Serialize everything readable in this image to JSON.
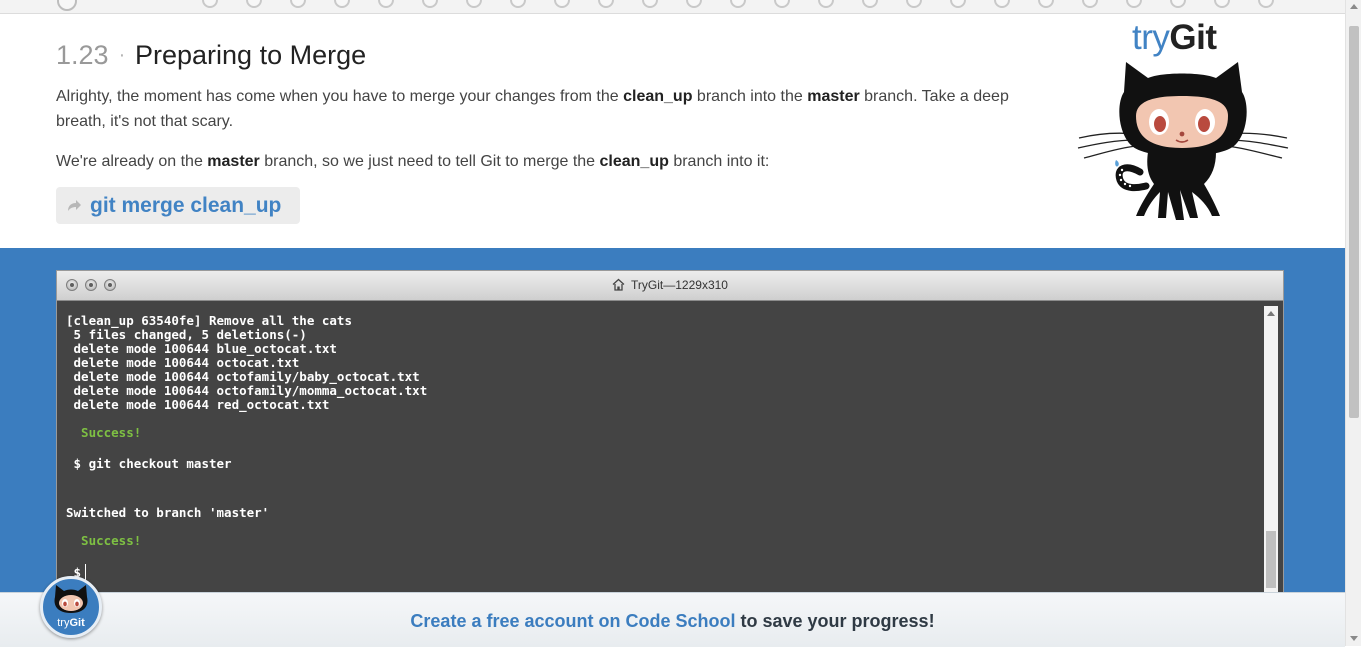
{
  "lesson": {
    "number": "1.23",
    "separator": "·",
    "title": "Preparing to Merge",
    "p1": [
      {
        "text": "Alrighty, the moment has come when you have to merge your changes from the ",
        "bold": false
      },
      {
        "text": "clean_up",
        "bold": true
      },
      {
        "text": " branch into the ",
        "bold": false
      },
      {
        "text": "master",
        "bold": true
      },
      {
        "text": " branch. Take a deep breath, it's not that scary.",
        "bold": false
      }
    ],
    "p2": [
      {
        "text": "We're already on the ",
        "bold": false
      },
      {
        "text": "master",
        "bold": true
      },
      {
        "text": " branch, so we just need to tell Git to merge the ",
        "bold": false
      },
      {
        "text": "clean_up",
        "bold": true
      },
      {
        "text": " branch into it:",
        "bold": false
      }
    ],
    "command": "git merge clean_up"
  },
  "logo": {
    "try": "try",
    "git": "Git"
  },
  "terminal": {
    "title": "TryGit—1229x310",
    "lines": [
      {
        "text": "[clean_up 63540fe] Remove all the cats",
        "kind": "out"
      },
      {
        "text": " 5 files changed, 5 deletions(-)",
        "kind": "out"
      },
      {
        "text": " delete mode 100644 blue_octocat.txt",
        "kind": "out"
      },
      {
        "text": " delete mode 100644 octocat.txt",
        "kind": "out"
      },
      {
        "text": " delete mode 100644 octofamily/baby_octocat.txt",
        "kind": "out"
      },
      {
        "text": " delete mode 100644 octofamily/momma_octocat.txt",
        "kind": "out"
      },
      {
        "text": " delete mode 100644 red_octocat.txt",
        "kind": "out"
      },
      {
        "text": "  Success!",
        "kind": "ok"
      },
      {
        "text": " $ git checkout master",
        "kind": "out"
      },
      {
        "text": "Switched to branch 'master'",
        "kind": "out"
      },
      {
        "text": "  Success!",
        "kind": "ok"
      },
      {
        "text": " $",
        "kind": "prompt"
      }
    ]
  },
  "signup": {
    "link": "Create a free account on Code School",
    "rest": " to save your progress!"
  },
  "badge": {
    "try": "try",
    "git": "Git"
  },
  "colors": {
    "accent": "#4183c4",
    "band": "#3b7dbf",
    "terminal_bg": "#444444",
    "success": "#7ec043"
  }
}
